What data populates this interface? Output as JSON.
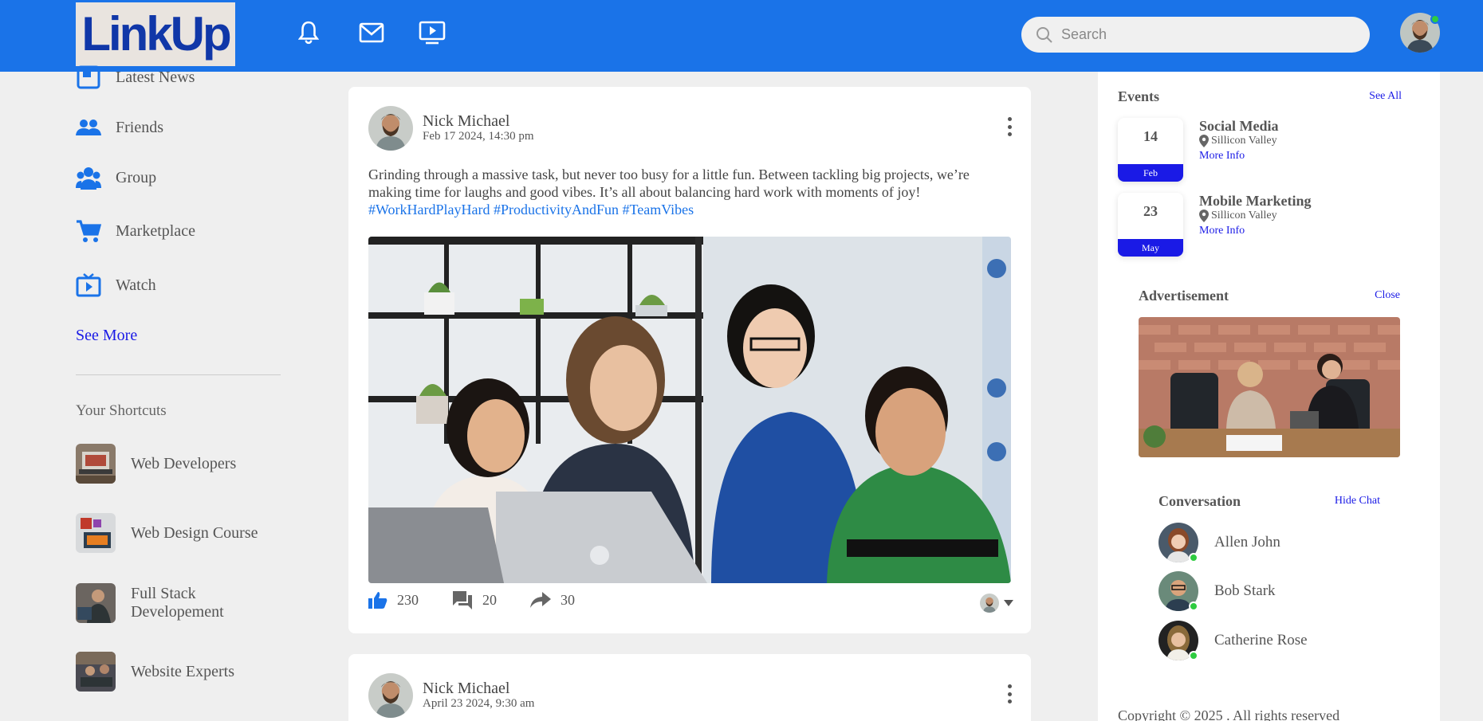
{
  "header": {
    "logo": "LinkUp",
    "search_placeholder": "Search"
  },
  "sidebar": {
    "items": [
      {
        "label": "Latest News",
        "icon": "news-icon"
      },
      {
        "label": "Friends",
        "icon": "friends-icon"
      },
      {
        "label": "Group",
        "icon": "group-icon"
      },
      {
        "label": "Marketplace",
        "icon": "cart-icon"
      },
      {
        "label": "Watch",
        "icon": "tv-icon"
      }
    ],
    "see_more": "See More",
    "shortcuts_title": "Your Shortcuts",
    "shortcuts": [
      {
        "label": "Web Developers"
      },
      {
        "label": "Web Design Course"
      },
      {
        "label": "Full Stack Developement"
      },
      {
        "label": "Website Experts"
      }
    ]
  },
  "feed": {
    "posts": [
      {
        "author": "Nick Michael",
        "date": "Feb 17 2024, 14:30 pm",
        "text": "Grinding through a massive task, but never too busy for a little fun. Between tackling big projects, we’re making time for laughs and good vibes. It’s all about balancing hard work with moments of joy!",
        "tags": "#WorkHardPlayHard #ProductivityAndFun #TeamVibes",
        "likes": "230",
        "comments": "20",
        "shares": "30"
      },
      {
        "author": "Nick Michael",
        "date": "April 23 2024, 9:30 am"
      }
    ]
  },
  "right": {
    "events_title": "Events",
    "see_all": "See All",
    "events": [
      {
        "day": "14",
        "month": "Feb",
        "name": "Social Media",
        "location": "Sillicon Valley",
        "more": "More Info"
      },
      {
        "day": "23",
        "month": "May",
        "name": "Mobile Marketing",
        "location": "Sillicon Valley",
        "more": "More Info"
      }
    ],
    "ad_title": "Advertisement",
    "ad_close": "Close",
    "conversation_title": "Conversation",
    "hide_chat": "Hide Chat",
    "contacts": [
      {
        "name": "Allen John"
      },
      {
        "name": "Bob Stark"
      },
      {
        "name": "Catherine Rose"
      }
    ],
    "copyright": "Copyright © 2025 . All rights reserved"
  },
  "colors": {
    "brand": "#1a73e8",
    "link": "#1a1ae6",
    "online": "#2ecc40"
  }
}
